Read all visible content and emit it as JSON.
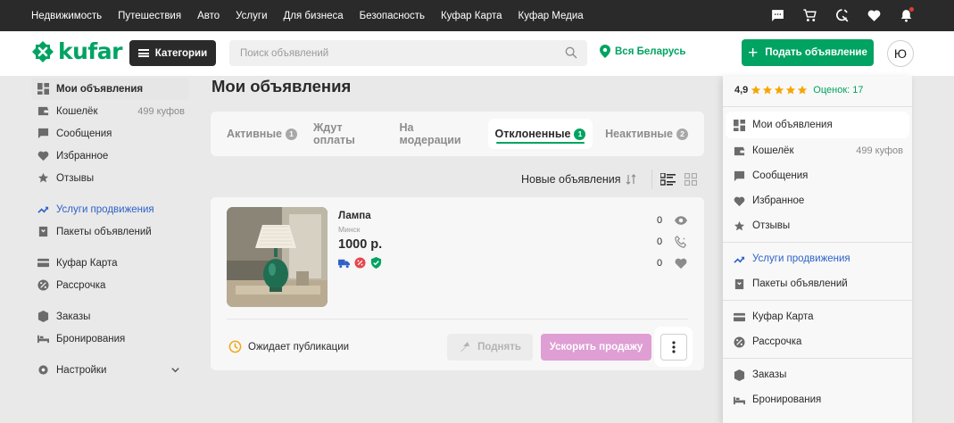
{
  "topnav": [
    "Недвижимость",
    "Путешествия",
    "Авто",
    "Услуги",
    "Для бизнеса",
    "Безопасность",
    "Куфар Карта",
    "Куфар Медиа"
  ],
  "top_icons": [
    "chat-icon",
    "cart-icon",
    "compare-icon",
    "heart-icon",
    "bell-icon"
  ],
  "header": {
    "logo_text": "kufar",
    "categories_label": "Категории",
    "search_placeholder": "Поиск объявлений",
    "location": "Вся Беларусь",
    "post_ad_label": "Подать объявление",
    "avatar_letter": "Ю"
  },
  "sidebar": {
    "items": [
      {
        "label": "Мои объявления",
        "icon": "dashboard-icon"
      },
      {
        "label": "Кошелёк",
        "meta": "499 куфов",
        "icon": "wallet-icon"
      },
      {
        "label": "Сообщения",
        "icon": "message-icon"
      },
      {
        "label": "Избранное",
        "icon": "heart-icon"
      },
      {
        "label": "Отзывы",
        "icon": "star-icon"
      },
      {
        "label": "Услуги продвижения",
        "icon": "trend-icon"
      },
      {
        "label": "Пакеты объявлений",
        "icon": "package-icon"
      },
      {
        "label": "Куфар Карта",
        "icon": "card-icon"
      },
      {
        "label": "Рассрочка",
        "icon": "installment-icon"
      },
      {
        "label": "Заказы",
        "icon": "box-icon"
      },
      {
        "label": "Бронирования",
        "icon": "bed-icon"
      },
      {
        "label": "Настройки",
        "icon": "gear-icon"
      }
    ]
  },
  "main": {
    "title": "Мои объявления",
    "tabs": [
      {
        "label": "Активные",
        "count": "1"
      },
      {
        "label": "Ждут оплаты"
      },
      {
        "label": "На модерации"
      },
      {
        "label": "Отклоненные",
        "count": "1",
        "active": true
      },
      {
        "label": "Неактивные",
        "count": "2"
      }
    ],
    "sort_label": "Новые объявления",
    "ad": {
      "title": "Лампа",
      "city": "Минск",
      "price": "1000 р.",
      "views": "0",
      "calls": "0",
      "favorites": "0",
      "status": "Ожидает публикации",
      "raise_label": "Поднять",
      "boost_label": "Ускорить продажу"
    }
  },
  "dropdown": {
    "rating": "4,9",
    "stars": 5,
    "reviews": "Оценок: 17",
    "items": [
      {
        "label": "Мои объявления",
        "icon": "dashboard-icon"
      },
      {
        "label": "Кошелёк",
        "meta": "499 куфов",
        "icon": "wallet-icon"
      },
      {
        "label": "Сообщения",
        "icon": "message-icon"
      },
      {
        "label": "Избранное",
        "icon": "heart-icon"
      },
      {
        "label": "Отзывы",
        "icon": "star-icon"
      },
      {
        "label": "Услуги продвижения",
        "icon": "trend-icon"
      },
      {
        "label": "Пакеты объявлений",
        "icon": "package-icon"
      },
      {
        "label": "Куфар Карта",
        "icon": "card-icon"
      },
      {
        "label": "Рассрочка",
        "icon": "installment-icon"
      },
      {
        "label": "Заказы",
        "icon": "box-icon"
      },
      {
        "label": "Бронирования",
        "icon": "bed-icon"
      }
    ]
  },
  "colors": {
    "brand": "#00a362",
    "link_blue": "#2e62c9",
    "boost": "#df9ed4",
    "star": "#f6a600"
  }
}
